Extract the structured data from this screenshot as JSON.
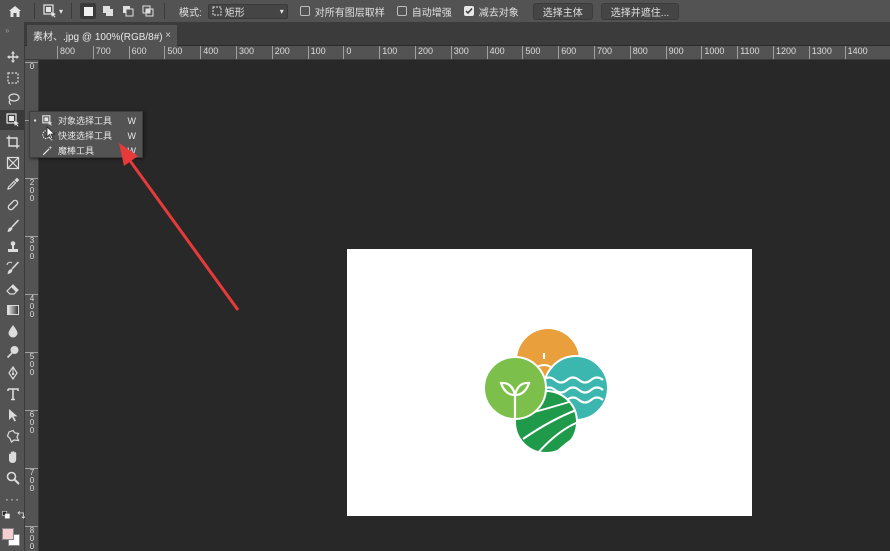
{
  "options_bar": {
    "mode_label": "模式:",
    "mode_value": "矩形",
    "sample_all_layers_label": "对所有图层取样",
    "sample_all_layers_checked": false,
    "auto_enhance_label": "自动增强",
    "auto_enhance_checked": false,
    "subtract_object_label": "减去对象",
    "subtract_object_checked": true,
    "select_subject_label": "选择主体",
    "select_and_mask_label": "选择并遮住..."
  },
  "document_tab": {
    "title": "素材、.jpg @ 100%(RGB/8#)",
    "close_glyph": "×"
  },
  "ruler_h": {
    "ticks": [
      "800",
      "700",
      "600",
      "500",
      "400",
      "300",
      "200",
      "100",
      "0",
      "100",
      "200",
      "300",
      "400",
      "500",
      "600",
      "700",
      "800",
      "900",
      "1000",
      "1100",
      "1200",
      "1300",
      "1400"
    ]
  },
  "ruler_v": {
    "ticks": [
      "0",
      "1\n0\n0",
      "2\n0\n0",
      "3\n0\n0",
      "4\n0\n0",
      "5\n0\n0",
      "6\n0\n0",
      "7\n0\n0",
      "8\n0\n0"
    ]
  },
  "flyout": {
    "items": [
      {
        "label": "对象选择工具",
        "key": "W",
        "icon": "object-select-icon",
        "current": true
      },
      {
        "label": "快速选择工具",
        "key": "W",
        "icon": "quick-select-icon",
        "current": false
      },
      {
        "label": "魔棒工具",
        "key": "W",
        "icon": "magic-wand-icon",
        "current": false
      }
    ]
  },
  "colors": {
    "foreground": "#f5cfcf",
    "background": "#ffffff",
    "annotation_arrow": "#e83a3a",
    "logo_orange": "#e9a03c",
    "logo_light_green": "#7cc04b",
    "logo_teal": "#3bb7b0",
    "logo_dark_green": "#1f9a4a"
  }
}
